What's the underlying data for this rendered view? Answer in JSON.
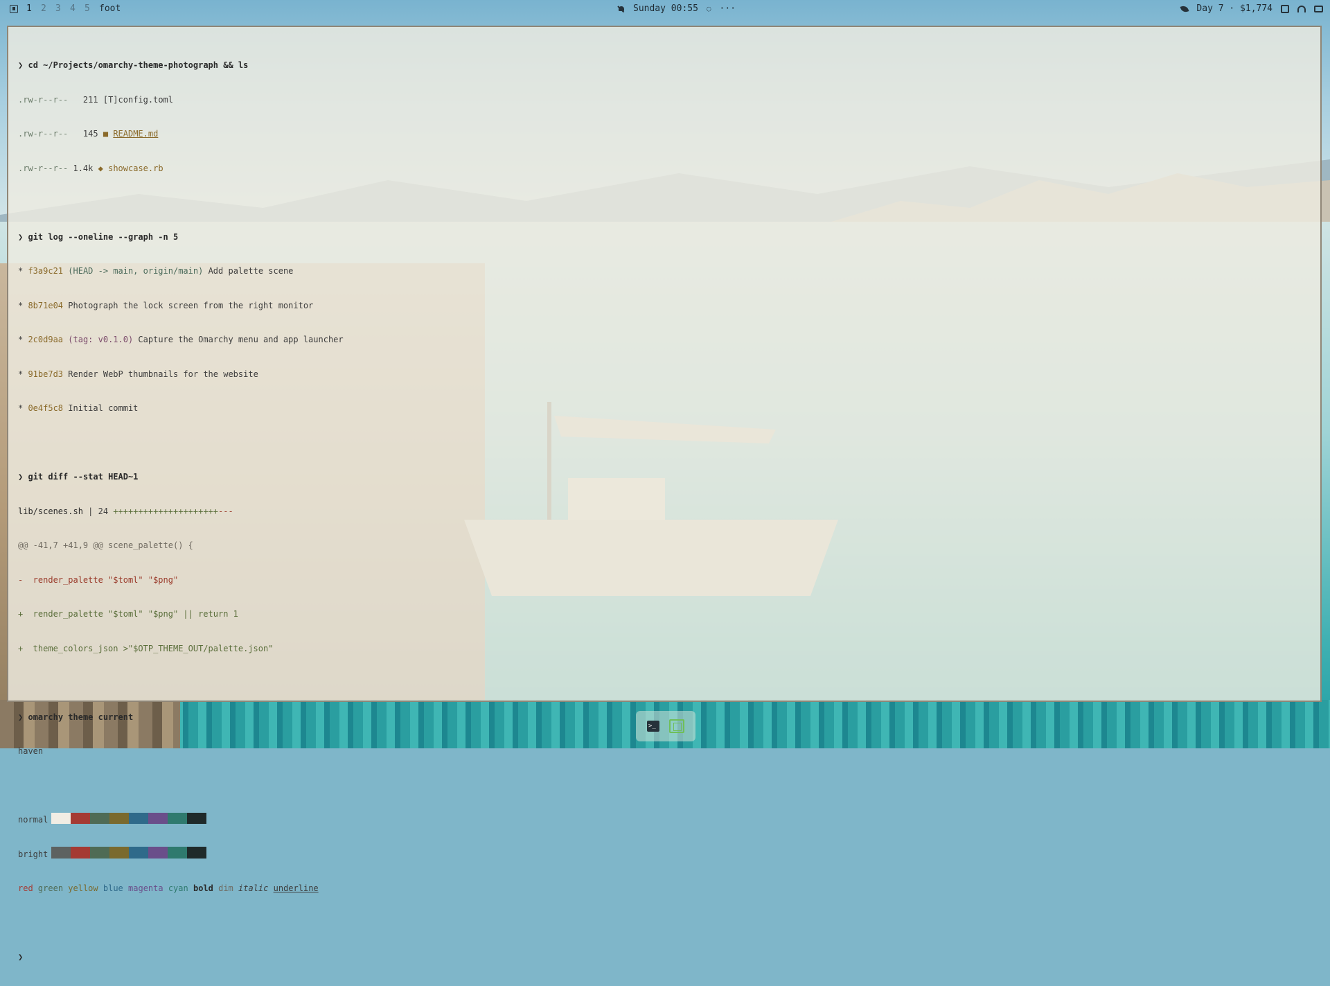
{
  "topbar": {
    "workspaces": [
      "1",
      "2",
      "3",
      "4",
      "5"
    ],
    "active_workspace": "1",
    "app": "foot",
    "clock": "Sunday 00:55",
    "more": "···",
    "status": "Day 7 · $1,774"
  },
  "terminal": {
    "prompt_symbol": "❯",
    "cmd1": "cd ~/Projects/omarchy-theme-photograph && ls",
    "ls": [
      {
        "perm": ".rw-r--r--",
        "size": " 211",
        "icon": "[T]",
        "name": "config.toml"
      },
      {
        "perm": ".rw-r--r--",
        "size": " 145",
        "icon": "■",
        "name": "README.md"
      },
      {
        "perm": ".rw-r--r--",
        "size": "1.4k",
        "icon": "◆",
        "name": "showcase.rb"
      }
    ],
    "cmd2": "git log --oneline --graph -n 5",
    "log": [
      {
        "hash": "f3a9c21",
        "ref": "(HEAD -> main, origin/main)",
        "msg": "Add palette scene"
      },
      {
        "hash": "8b71e04",
        "ref": "",
        "msg": "Photograph the lock screen from the right monitor"
      },
      {
        "hash": "2c0d9aa",
        "ref": "(tag: v0.1.0)",
        "msg": "Capture the Omarchy menu and app launcher"
      },
      {
        "hash": "91be7d3",
        "ref": "",
        "msg": "Render WebP thumbnails for the website"
      },
      {
        "hash": "0e4f5c8",
        "ref": "",
        "msg": "Initial commit"
      }
    ],
    "cmd3": "git diff --stat HEAD~1",
    "diffstat_file": "lib/scenes.sh",
    "diffstat_rest": " | 24 ",
    "diffstat_plus": "+++++++++++++++++++++",
    "diffstat_minus": "---",
    "hunk": "@@ -41,7 +41,9 @@ scene_palette() {",
    "diff_minus": "-  render_palette \"$toml\" \"$png\"",
    "diff_plus1": "+  render_palette \"$toml\" \"$png\" || return 1",
    "diff_plus2": "+  theme_colors_json >\"$OTP_THEME_OUT/palette.json\"",
    "cmd4": "omarchy theme current",
    "theme": "haven",
    "normal_label": "normal",
    "bright_label": "bright",
    "normal_colors": [
      "#f1ede4",
      "#a53a33",
      "#4f6b55",
      "#7a6a2e",
      "#2f6a8a",
      "#6a4e8a",
      "#2f7a6e",
      "#1f2a2a"
    ],
    "bright_colors": [
      "#5d6260",
      "#a53a33",
      "#4f6b55",
      "#7a6a2e",
      "#2f6a8a",
      "#6a4e8a",
      "#2f7a6e",
      "#1f2a2a"
    ],
    "style_words": {
      "red": "red",
      "green": "green",
      "yellow": "yellow",
      "blue": "blue",
      "magenta": "magenta",
      "cyan": "cyan",
      "bold": "bold",
      "dim": "dim",
      "italic": "italic",
      "underline": "underline"
    },
    "style_colors": {
      "red": "#a53a33",
      "green": "#4f6b55",
      "yellow": "#7a6a2e",
      "blue": "#2f6a8a",
      "magenta": "#6a4e8a",
      "cyan": "#2f7a6e"
    }
  }
}
